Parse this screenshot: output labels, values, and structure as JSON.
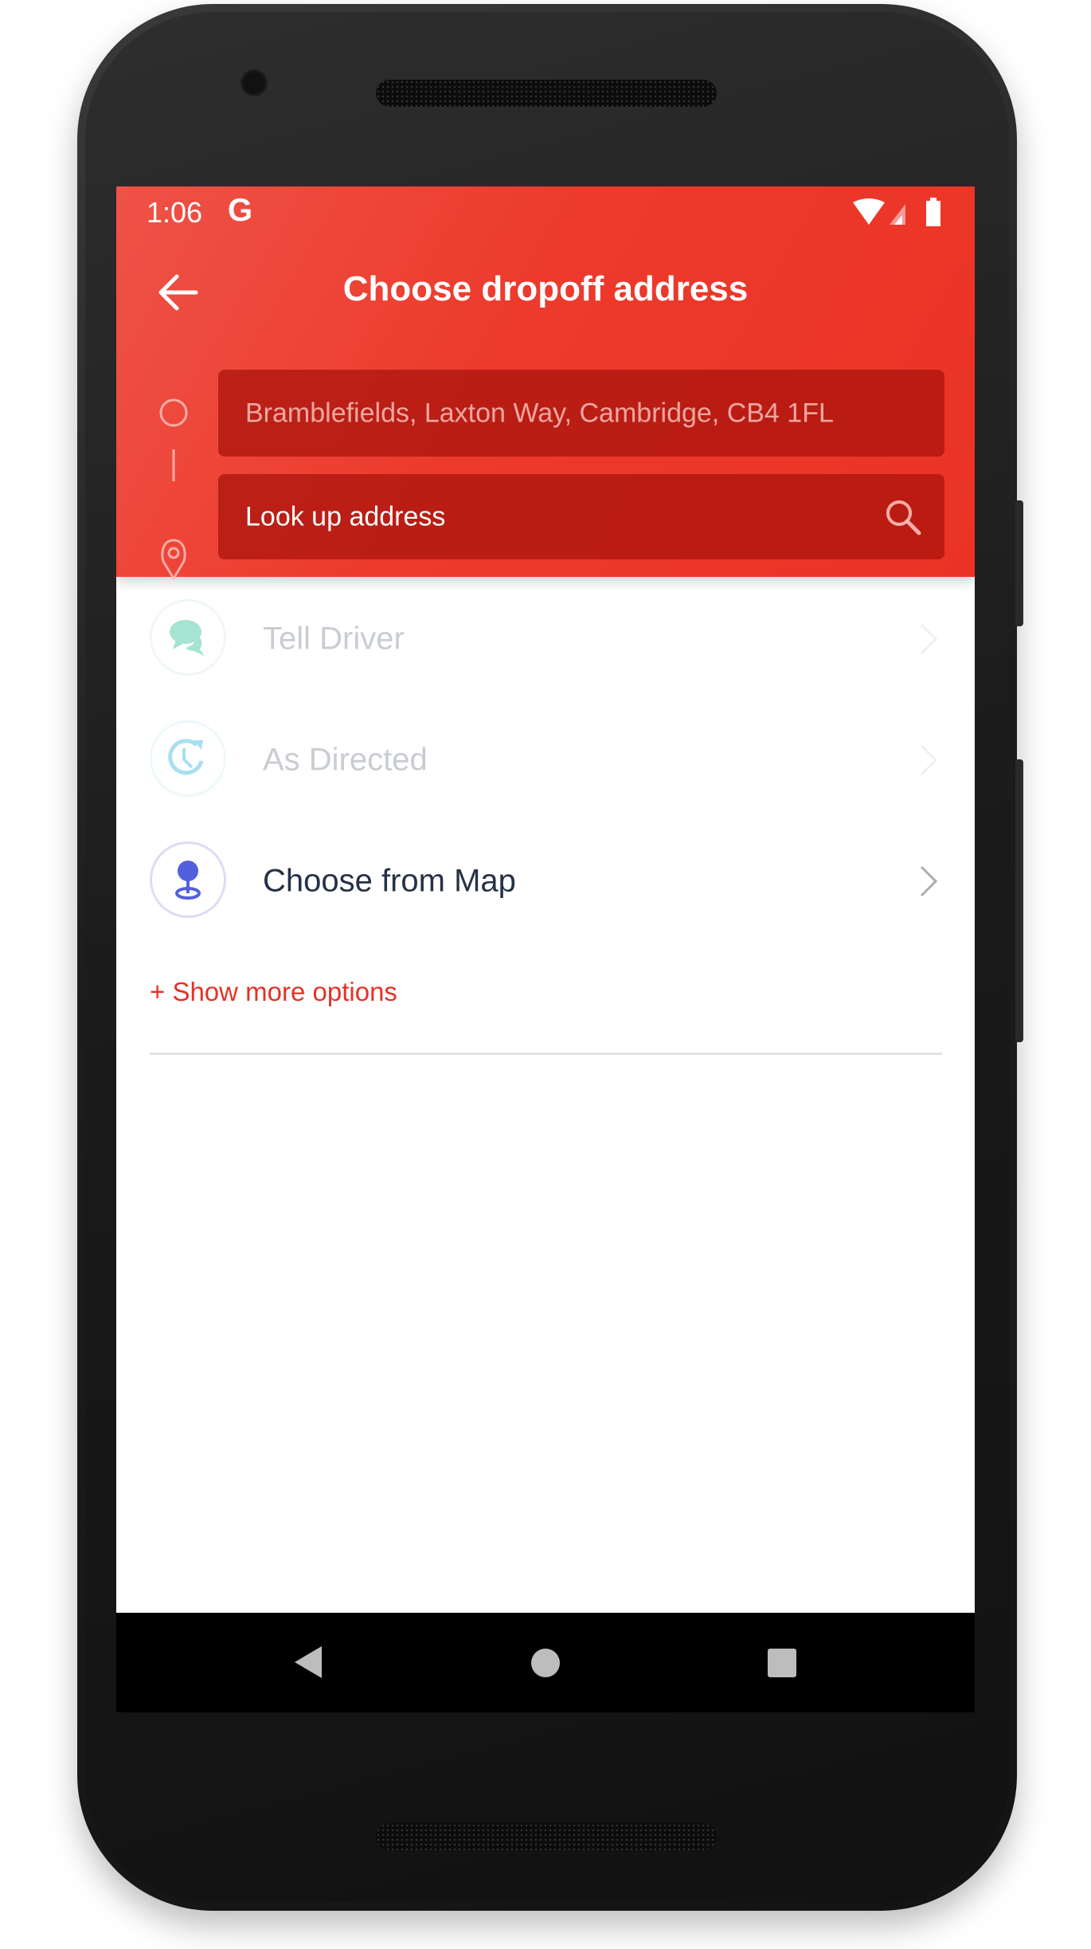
{
  "status_bar": {
    "time": "1:06",
    "google_icon": "G",
    "icons": [
      "wifi-icon",
      "signal-icon",
      "battery-icon"
    ]
  },
  "header": {
    "title": "Choose dropoff address",
    "back_icon": "arrow-left-icon"
  },
  "route": {
    "pickup": {
      "value": "Bramblefields, Laxton Way, Cambridge, CB4 1FL",
      "icon": "circle-icon"
    },
    "dropoff": {
      "placeholder": "Look up address",
      "icon": "pin-icon",
      "action_icon": "search-icon"
    }
  },
  "options": [
    {
      "label": "Tell Driver",
      "icon": "chat-bubbles-icon",
      "enabled": false,
      "color": "#a6e3d2"
    },
    {
      "label": "As Directed",
      "icon": "clock-refresh-icon",
      "enabled": false,
      "color": "#a8e0ef"
    },
    {
      "label": "Choose from Map",
      "icon": "map-pin-icon",
      "enabled": true,
      "color": "#5360de"
    }
  ],
  "show_more": "+ Show more options",
  "colors": {
    "accent": "#ea3326",
    "text_dark": "#253246",
    "text_disabled": "#c9cdd2"
  },
  "nav_bar": {
    "icons": [
      "back-triangle-icon",
      "home-circle-icon",
      "recents-square-icon"
    ]
  }
}
